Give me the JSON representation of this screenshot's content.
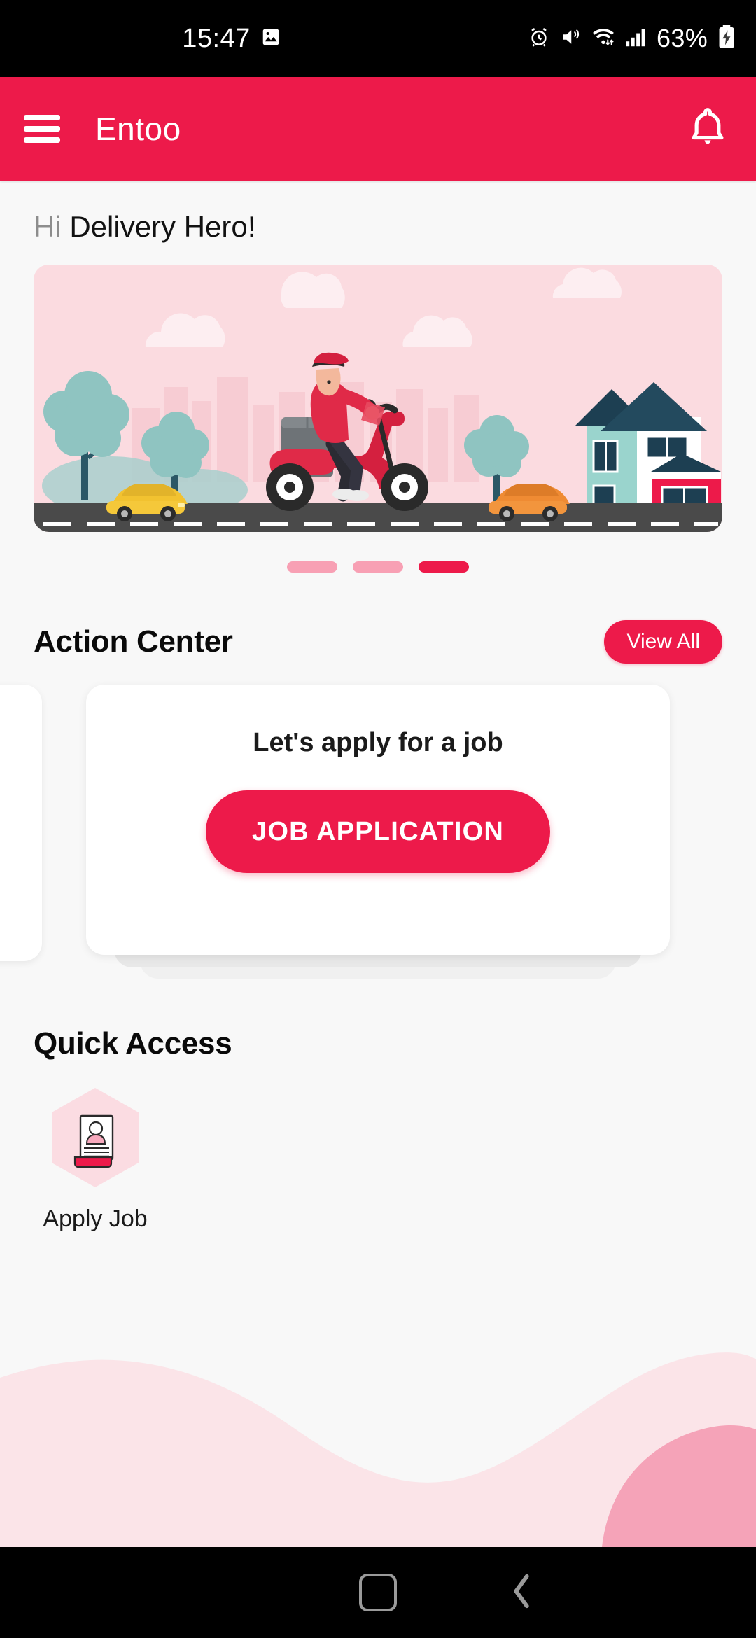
{
  "statusbar": {
    "time": "15:47",
    "battery_percent": "63%",
    "icons": [
      "image-icon",
      "alarm-icon",
      "vibrate-icon",
      "wifi-icon",
      "signal-icon",
      "battery-charging-icon"
    ]
  },
  "appbar": {
    "title": "Entoo",
    "menu_icon": "hamburger-menu-icon",
    "notification_icon": "bell-icon",
    "background_color": "#ed1a4a"
  },
  "greeting": {
    "prefix": "Hi ",
    "name": "Delivery Hero!"
  },
  "hero": {
    "alt": "delivery rider on red scooter illustration",
    "sky_color": "#fbdbe0",
    "road_color": "#4a4a4a",
    "scooter_color": "#e02244",
    "tree_color": "#8fc4c1"
  },
  "carousel": {
    "dots": [
      {
        "active": false
      },
      {
        "active": false
      },
      {
        "active": true
      }
    ]
  },
  "action_center": {
    "title": "Action Center",
    "view_all_label": "View All",
    "card": {
      "title": "Let's apply for a job",
      "button_label": "JOB APPLICATION"
    }
  },
  "quick_access": {
    "title": "Quick Access",
    "items": [
      {
        "label": "Apply Job",
        "icon": "resume-document-icon"
      }
    ]
  },
  "decor": {
    "wave_light": "#fbe4e8",
    "wave_dark": "#f5a3b8"
  },
  "navbar": {
    "home_icon": "home-square-icon",
    "back_icon": "back-chevron-icon"
  },
  "theme": {
    "brand_red": "#ed1a4a",
    "page_bg": "#f8f8f8",
    "card_bg": "#ffffff"
  }
}
